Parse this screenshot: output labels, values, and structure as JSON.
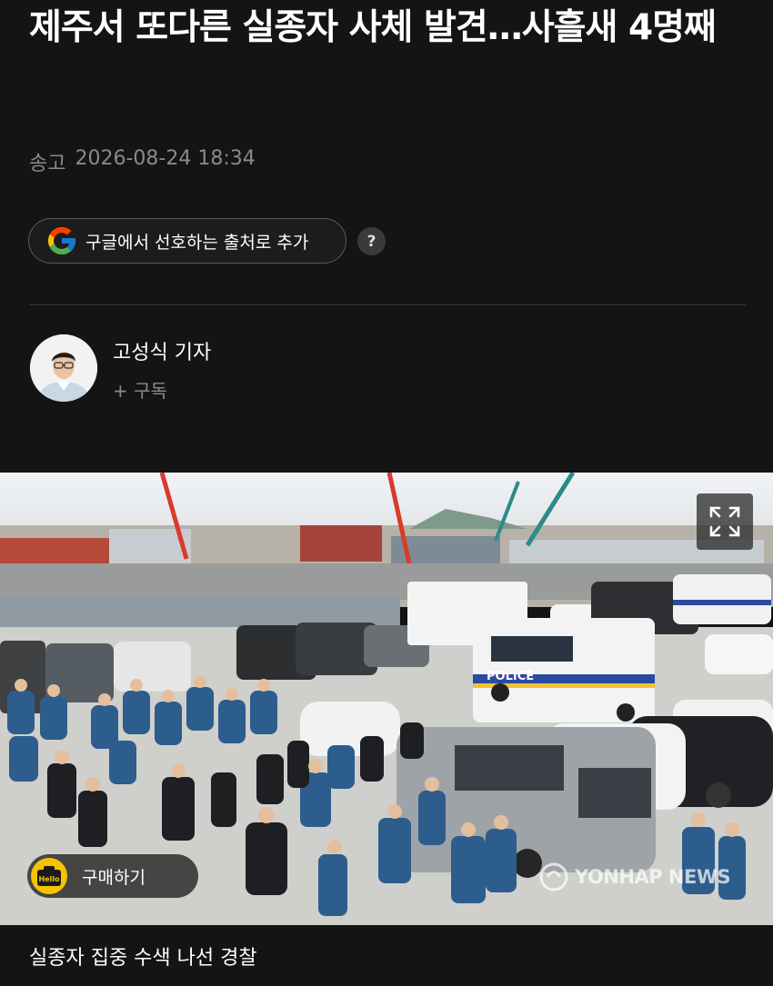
{
  "article": {
    "headline": "제주서 또다른 실종자 사체 발견…사흘새 4명째",
    "meta_label": "송고",
    "meta_datetime": "2026-08-24 18:34"
  },
  "preferred_source": {
    "label": "구글에서 선호하는 출처로 추가",
    "help_icon": "question-icon",
    "help_glyph": "?"
  },
  "reporter": {
    "name": "고성식 기자",
    "subscribe_label": "+ 구독"
  },
  "photo": {
    "expand_icon": "expand-icon",
    "buy_label": "구매하기",
    "hello_badge": "Hello",
    "watermark": "YONHAP NEWS",
    "caption": "실종자 집중 수색 나선 경찰"
  },
  "colors": {
    "background": "#141414",
    "meta_text": "#8a8a8a",
    "police_uniform": "#2d5d8c",
    "hello_yellow": "#f5c400"
  }
}
